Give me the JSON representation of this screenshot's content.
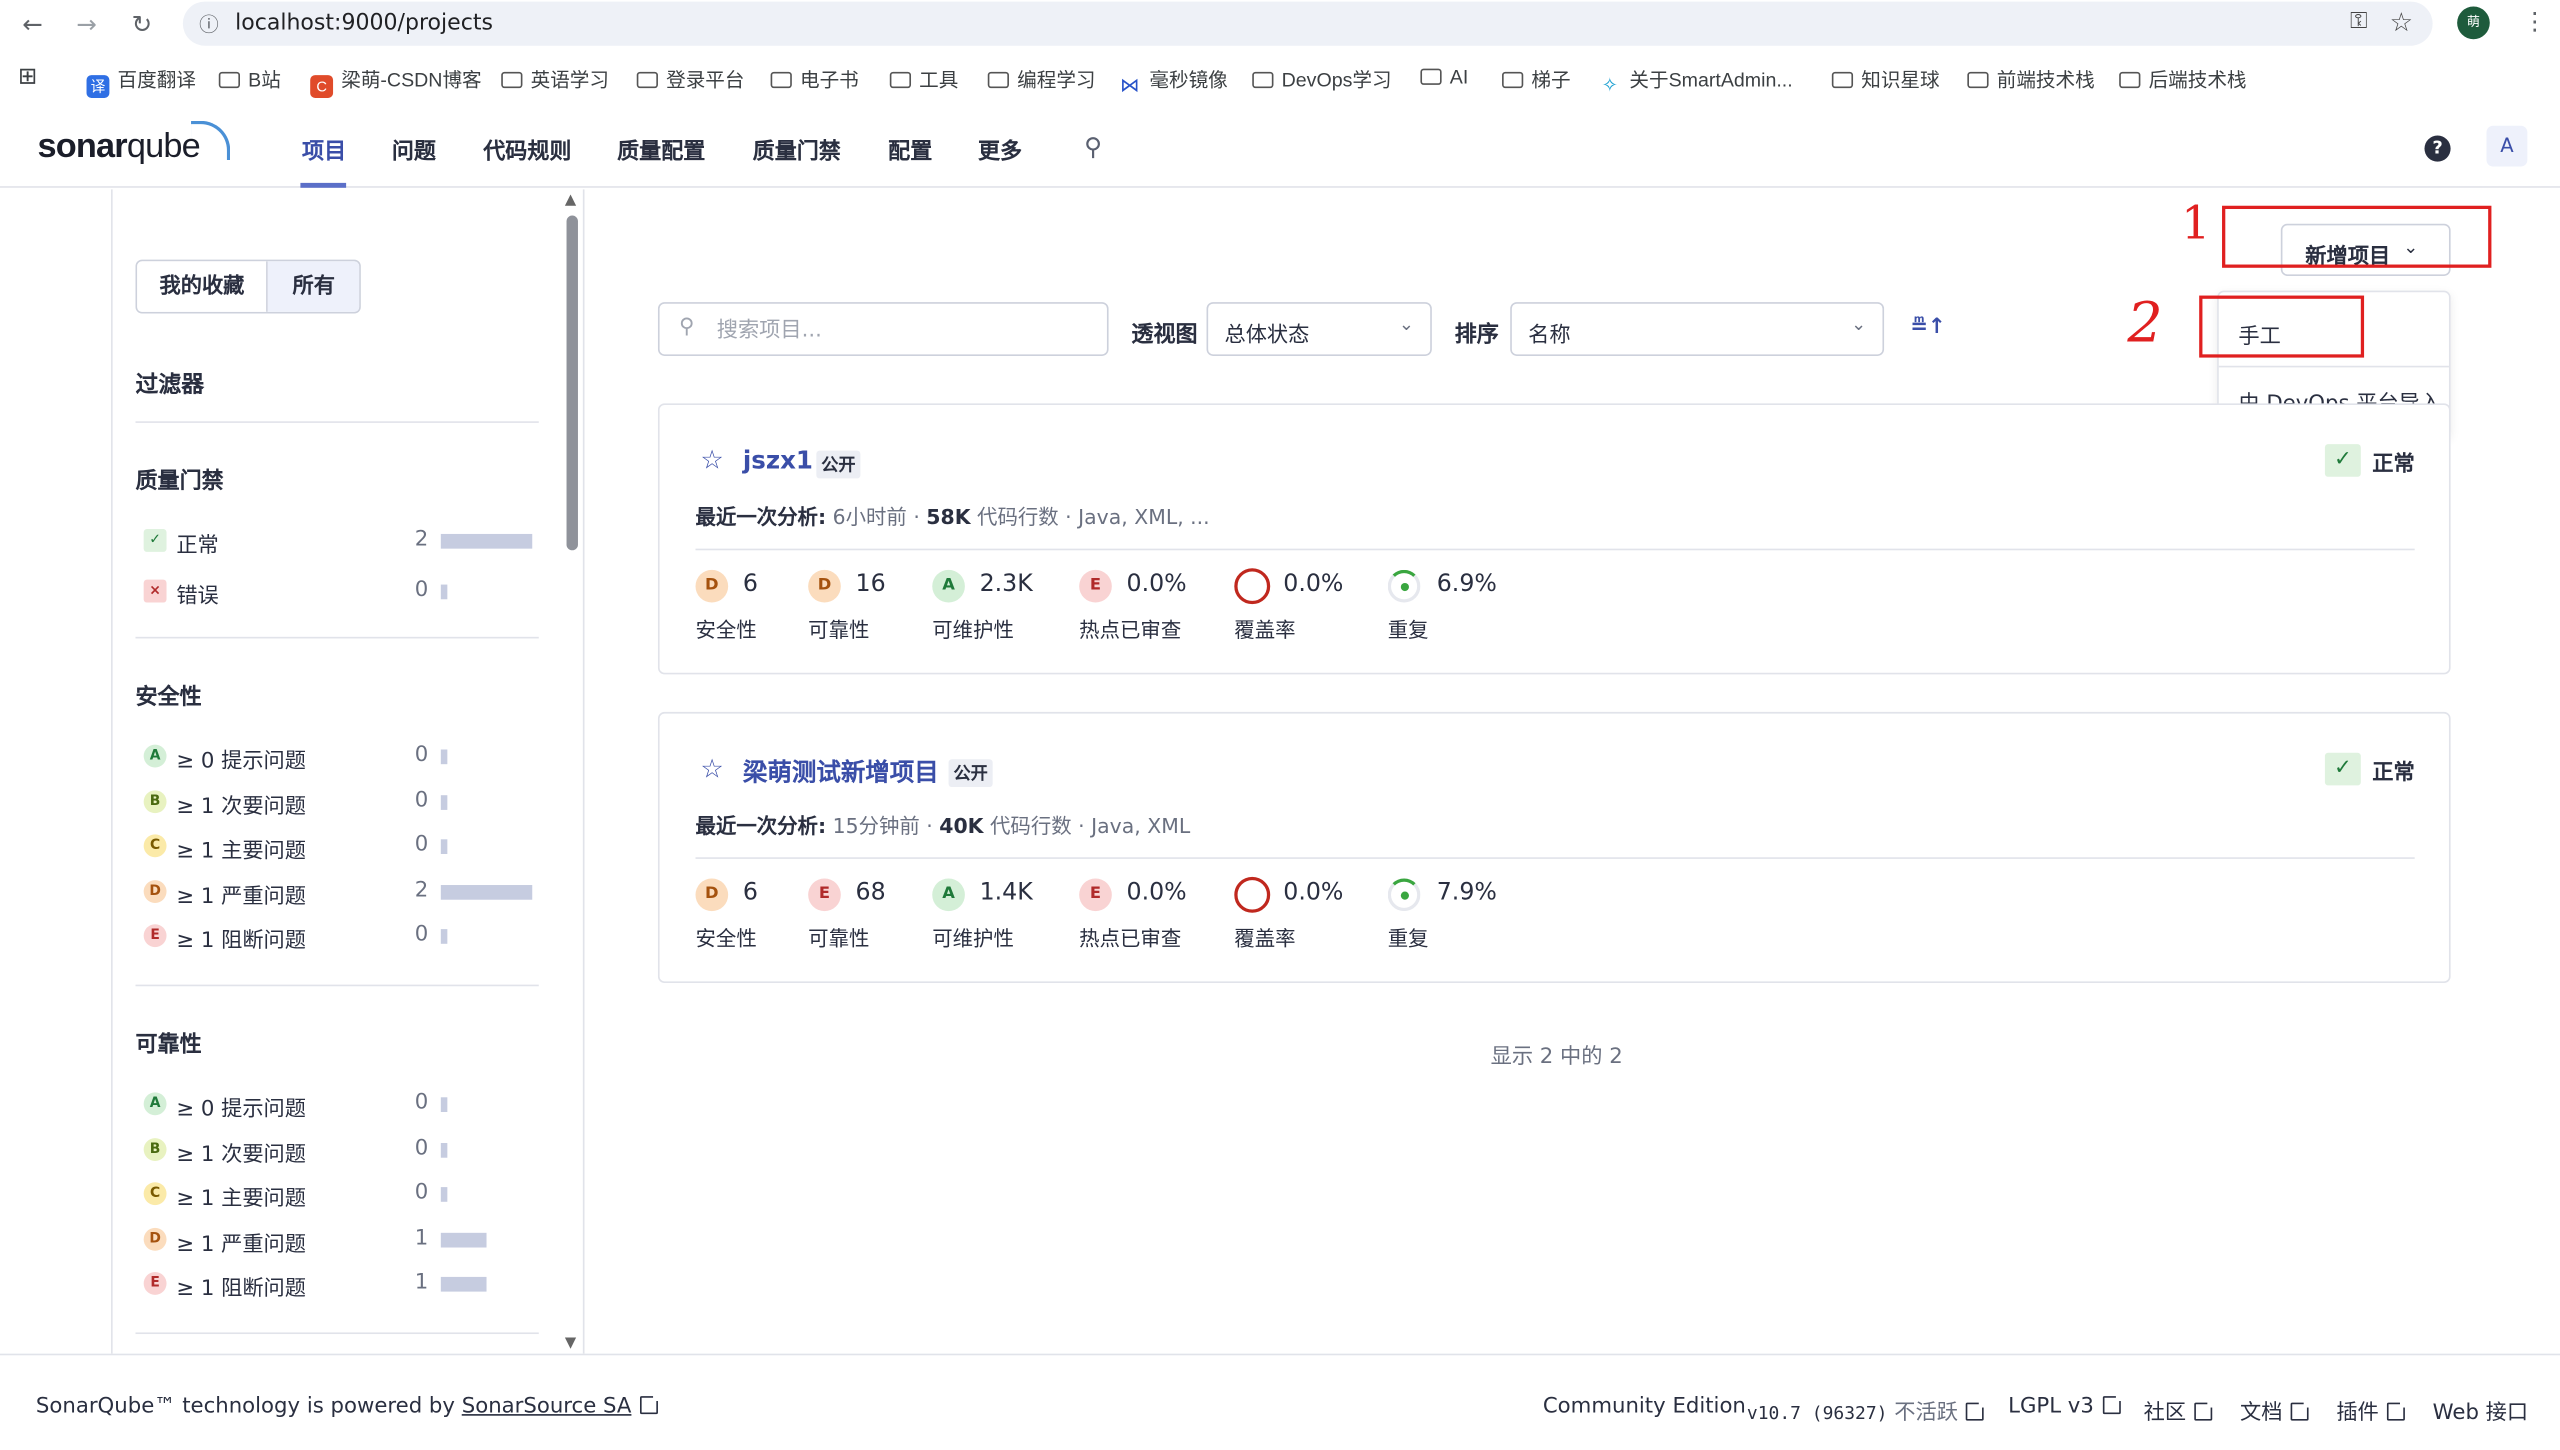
{
  "browser": {
    "url": "localhost:9000/projects",
    "profile_initial": "萌",
    "bookmarks": [
      "百度翻译",
      "B站",
      "梁萌-CSDN博客",
      "英语学习",
      "登录平台",
      "电子书",
      "工具",
      "编程学习",
      "毫秒镜像",
      "DevOps学习",
      "AI",
      "梯子",
      "关于SmartAdmin...",
      "知识星球",
      "前端技术栈",
      "后端技术栈"
    ]
  },
  "header": {
    "logo_text_a": "sonar",
    "logo_text_b": "qube",
    "nav": [
      "项目",
      "问题",
      "代码规则",
      "质量配置",
      "质量门禁",
      "配置",
      "更多"
    ],
    "active_nav_index": 0,
    "avatar": "A",
    "help": "?"
  },
  "sidebar": {
    "tabs": [
      "我的收藏",
      "所有"
    ],
    "filters_title": "过滤器",
    "quality_gate": {
      "title": "质量门禁",
      "items": [
        {
          "icon": "✓",
          "label": "正常",
          "count": "2",
          "bar": 1.0
        },
        {
          "icon": "×",
          "label": "错误",
          "count": "0",
          "bar": 0
        }
      ]
    },
    "security": {
      "title": "安全性",
      "items": [
        {
          "grade": "A",
          "label": "≥ 0 提示问题",
          "count": "0",
          "bar": 0
        },
        {
          "grade": "B",
          "label": "≥ 1 次要问题",
          "count": "0",
          "bar": 0
        },
        {
          "grade": "C",
          "label": "≥ 1 主要问题",
          "count": "0",
          "bar": 0
        },
        {
          "grade": "D",
          "label": "≥ 1 严重问题",
          "count": "2",
          "bar": 1.0
        },
        {
          "grade": "E",
          "label": "≥ 1 阻断问题",
          "count": "0",
          "bar": 0
        }
      ]
    },
    "reliability": {
      "title": "可靠性",
      "items": [
        {
          "grade": "A",
          "label": "≥ 0 提示问题",
          "count": "0",
          "bar": 0
        },
        {
          "grade": "B",
          "label": "≥ 1 次要问题",
          "count": "0",
          "bar": 0
        },
        {
          "grade": "C",
          "label": "≥ 1 主要问题",
          "count": "0",
          "bar": 0
        },
        {
          "grade": "D",
          "label": "≥ 1 严重问题",
          "count": "1",
          "bar": 0.5
        },
        {
          "grade": "E",
          "label": "≥ 1 阻断问题",
          "count": "1",
          "bar": 0.5
        }
      ]
    }
  },
  "toolbar": {
    "search_placeholder": "搜索项目...",
    "perspective_label": "透视图",
    "perspective_value": "总体状态",
    "sort_label": "排序",
    "sort_value": "名称",
    "sort_dir_icon": "≞↑",
    "new_project": "新增项目",
    "dropdown": [
      "手工",
      "由 DevOps 平台导入"
    ]
  },
  "annotations": {
    "one": "1",
    "two": "2"
  },
  "projects": [
    {
      "name": "jszx1",
      "visibility": "公开",
      "status": "正常",
      "meta_label": "最近一次分析:",
      "meta_time": "6小时前",
      "meta_loc": "58K",
      "meta_loc_label": "代码行数",
      "meta_lang": "Java, XML, ...",
      "metrics": [
        {
          "grade": "D",
          "value": "6",
          "label": "安全性"
        },
        {
          "grade": "D",
          "value": "16",
          "label": "可靠性"
        },
        {
          "grade": "A",
          "value": "2.3K",
          "label": "可维护性"
        },
        {
          "grade": "E",
          "value": "0.0%",
          "label": "热点已审查"
        },
        {
          "grade": "",
          "value": "0.0%",
          "label": "覆盖率"
        },
        {
          "grade": "",
          "value": "6.9%",
          "label": "重复"
        }
      ]
    },
    {
      "name": "梁萌测试新增项目",
      "visibility": "公开",
      "status": "正常",
      "meta_label": "最近一次分析:",
      "meta_time": "15分钟前",
      "meta_loc": "40K",
      "meta_loc_label": "代码行数",
      "meta_lang": "Java, XML",
      "metrics": [
        {
          "grade": "D",
          "value": "6",
          "label": "安全性"
        },
        {
          "grade": "E",
          "value": "68",
          "label": "可靠性"
        },
        {
          "grade": "A",
          "value": "1.4K",
          "label": "可维护性"
        },
        {
          "grade": "E",
          "value": "0.0%",
          "label": "热点已审查"
        },
        {
          "grade": "",
          "value": "0.0%",
          "label": "覆盖率"
        },
        {
          "grade": "",
          "value": "7.9%",
          "label": "重复"
        }
      ]
    }
  ],
  "showing": "显示 2 中的 2",
  "footer": {
    "powered": "SonarQube™ technology is powered by",
    "powered_link": "SonarSource SA",
    "edition": "Community Edition",
    "version": "v10.7 (96327)",
    "inactive": "不活跃",
    "license": "LGPL v3",
    "community": "社区",
    "docs": "文档",
    "plugins": "插件",
    "webapi": "Web 接口"
  },
  "colors": {
    "accent": "#3a4ea8",
    "gradeA": "#d4efd7",
    "gradeB": "#e8f2c0",
    "gradeC": "#fbeaa8",
    "gradeD": "#fbdcbd",
    "gradeE": "#f9d3d3",
    "annotation": "#e02020"
  }
}
